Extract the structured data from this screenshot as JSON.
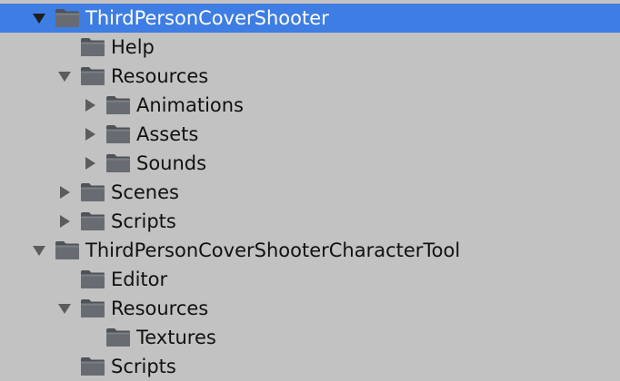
{
  "colors": {
    "background": "#c2c2c2",
    "selection": "#3e7de3",
    "text": "#111111",
    "selected_text": "#ffffff"
  },
  "tree": [
    {
      "label": "ThirdPersonCoverShooter",
      "state": "expanded",
      "selected": true,
      "icon": "folder-icon"
    },
    {
      "label": "Help",
      "state": "leaf",
      "icon": "folder-icon"
    },
    {
      "label": "Resources",
      "state": "expanded",
      "icon": "folder-icon"
    },
    {
      "label": "Animations",
      "state": "collapsed",
      "icon": "folder-icon"
    },
    {
      "label": "Assets",
      "state": "collapsed",
      "icon": "folder-icon"
    },
    {
      "label": "Sounds",
      "state": "collapsed",
      "icon": "folder-icon"
    },
    {
      "label": "Scenes",
      "state": "collapsed",
      "icon": "folder-icon"
    },
    {
      "label": "Scripts",
      "state": "collapsed",
      "icon": "folder-icon"
    },
    {
      "label": "ThirdPersonCoverShooterCharacterTool",
      "state": "expanded",
      "icon": "folder-icon"
    },
    {
      "label": "Editor",
      "state": "leaf",
      "icon": "folder-icon"
    },
    {
      "label": "Resources",
      "state": "expanded",
      "icon": "folder-icon"
    },
    {
      "label": "Textures",
      "state": "leaf",
      "icon": "folder-icon"
    },
    {
      "label": "Scripts",
      "state": "leaf",
      "icon": "folder-icon"
    }
  ]
}
